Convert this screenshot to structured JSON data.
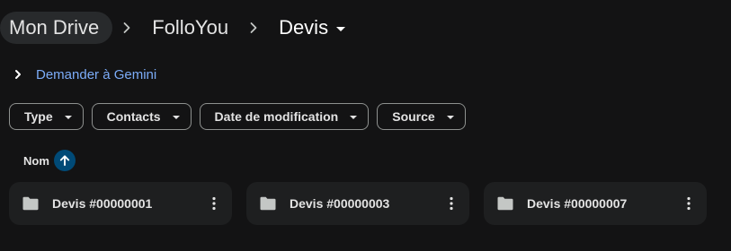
{
  "breadcrumb": {
    "items": [
      {
        "label": "Mon Drive"
      },
      {
        "label": "FolloYou"
      },
      {
        "label": "Devis"
      }
    ],
    "separator_icon": "chevron-right-icon",
    "current_dropdown_icon": "caret-down-icon"
  },
  "gemini": {
    "label": "Demander à Gemini",
    "icon": "chevron-right-icon",
    "color": "#7cacf8"
  },
  "filters": [
    {
      "label": "Type"
    },
    {
      "label": "Contacts"
    },
    {
      "label": "Date de modification"
    },
    {
      "label": "Source"
    }
  ],
  "sort": {
    "label": "Nom",
    "direction": "ascending",
    "icon": "arrow-up-icon",
    "accent": "#004a77"
  },
  "folders": [
    {
      "name": "Devis #00000001"
    },
    {
      "name": "Devis #00000003"
    },
    {
      "name": "Devis #00000007"
    }
  ],
  "colors": {
    "background": "#131314",
    "card": "#1e1f20",
    "text": "#e3e3e3"
  }
}
